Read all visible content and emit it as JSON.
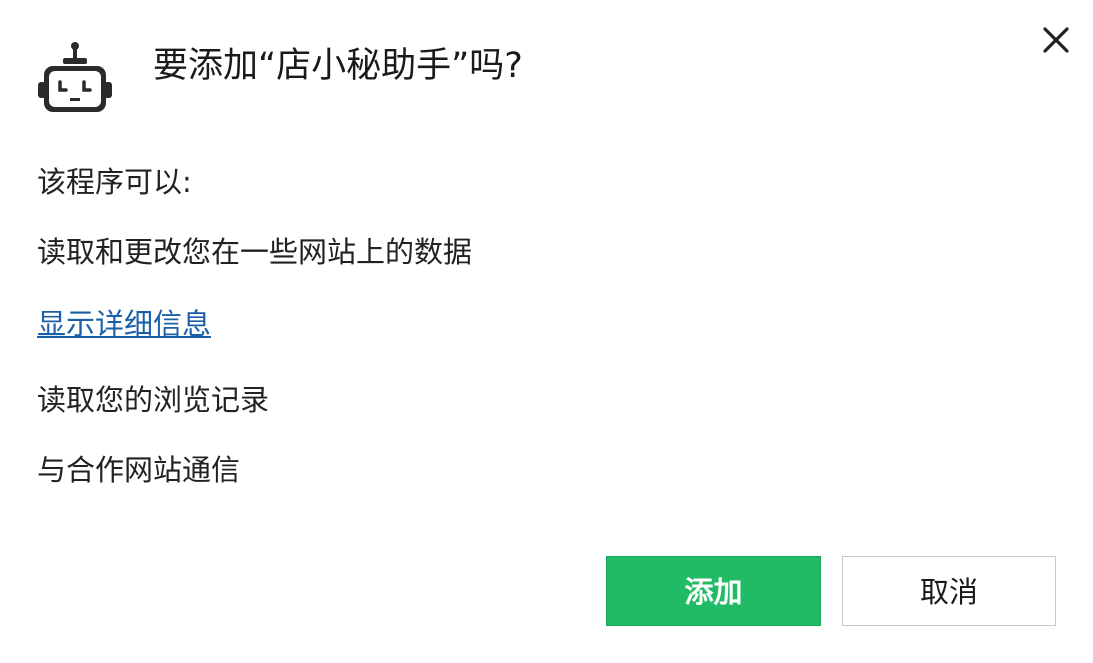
{
  "dialog": {
    "title": "要添加“店小秘助手”吗?",
    "close_icon": "close-icon",
    "app_icon": "robot-icon"
  },
  "permissions": {
    "heading": "该程序可以:",
    "item_1": "读取和更改您在一些网站上的数据",
    "details_link": "显示详细信息",
    "item_2": "读取您的浏览记录",
    "item_3": "与合作网站通信"
  },
  "buttons": {
    "add_label": "添加",
    "cancel_label": "取消"
  },
  "colors": {
    "add_button": "#21bb66",
    "link": "#1a5fa8"
  }
}
